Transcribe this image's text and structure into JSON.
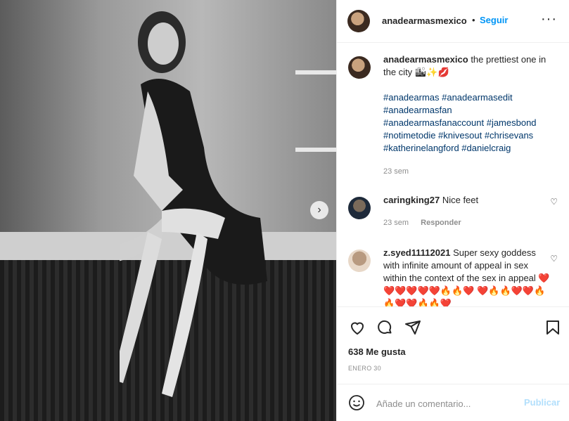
{
  "post": {
    "author": "anadearmasmexico",
    "dot": "•",
    "follow_label": "Seguir",
    "more": "···"
  },
  "caption": {
    "username": "anadearmasmexico",
    "text": "the prettiest one in the city 🏙✨💋",
    "hashtags": "#anadearmas #anadearmasedit #anadearmasfan #anadearmasfanaccount #jamesbond #notimetodie #knivesout #chrisevans #katherinelangford #danielcraig",
    "time": "23 sem"
  },
  "comments": [
    {
      "username": "caringking27",
      "text": "Nice feet",
      "time": "23 sem",
      "reply": "Responder"
    },
    {
      "username": "z.syed11112021",
      "text": "Super sexy goddess with infinite amount of appeal in sex within the context of the sex in appeal ❤️❤️❤️❤️❤️❤️🔥🔥❤️ ❤️🔥🔥❤️❤️🔥🔥❤️❤️🔥🔥❤️"
    }
  ],
  "stats": {
    "likes": "638 Me gusta",
    "date": "ENERO 30"
  },
  "composer": {
    "placeholder": "Añade un comentario...",
    "publish_label": "Publicar"
  },
  "icons": {
    "like": "heart-icon",
    "comment": "comment-icon",
    "share": "paper-plane-icon",
    "save": "bookmark-icon",
    "emoji": "smiley-icon",
    "next": "chevron-right-icon"
  },
  "colors": {
    "accent": "#0095f6",
    "hashtag": "#00376b",
    "muted": "#8e8e8e",
    "publish_disabled": "#b2dffc"
  }
}
